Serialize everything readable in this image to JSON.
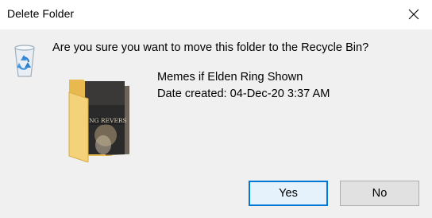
{
  "window": {
    "title": "Delete Folder",
    "close_icon": "close-icon"
  },
  "dialog": {
    "question": "Are you sure you want to move this folder to the Recycle Bin?",
    "icon": "recycle-bin-icon",
    "folder": {
      "name": "Memes if Elden Ring Shown",
      "date_created": "Date created: 04-Dec-20 3:37 AM",
      "thumbnail_caption": "ING REVERS",
      "icon": "folder-thumbnail-icon"
    }
  },
  "buttons": {
    "yes_label": "Yes",
    "no_label": "No"
  },
  "colors": {
    "title_bg": "#ffffff",
    "body_bg": "#f0f0f0",
    "accent": "#0078d7",
    "button_bg": "#e1e1e1",
    "default_button_bg": "#e5f1fb",
    "folder_yellow": "#f3d27a"
  }
}
